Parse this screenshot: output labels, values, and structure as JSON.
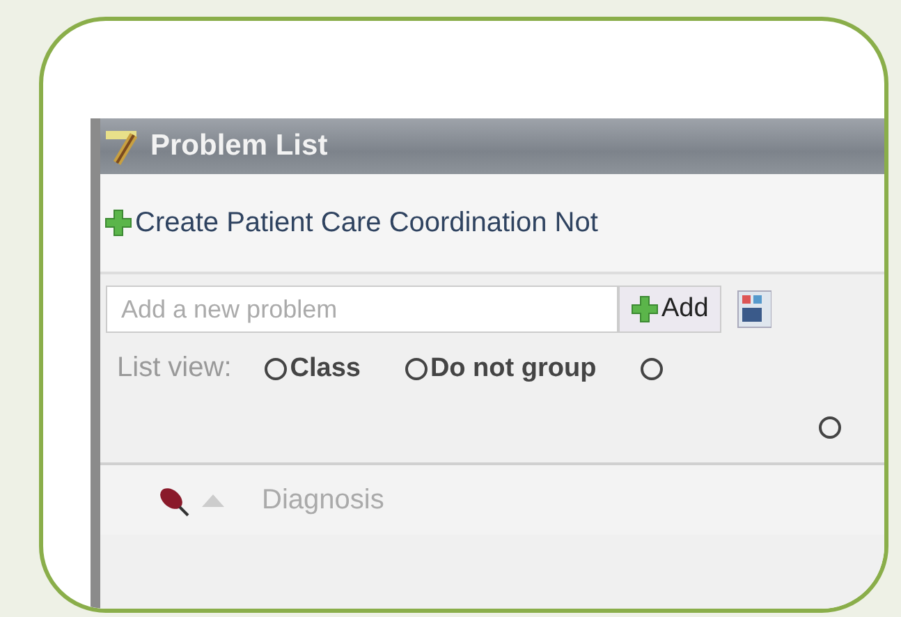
{
  "window": {
    "title": "Problem List"
  },
  "toolbar": {
    "link": "Create Patient Care Coordination Not"
  },
  "add_row": {
    "placeholder": "Add a new problem",
    "button": "Add"
  },
  "list_view": {
    "label": "List view:",
    "options": [
      {
        "label": "Class",
        "selected": false
      },
      {
        "label": "Do not group",
        "selected": false
      },
      {
        "selected": false
      }
    ]
  },
  "second_row": {
    "options": [
      {
        "selected": false
      }
    ]
  },
  "table": {
    "columns": [
      {
        "label": "Diagnosis",
        "sorted": true
      }
    ]
  }
}
